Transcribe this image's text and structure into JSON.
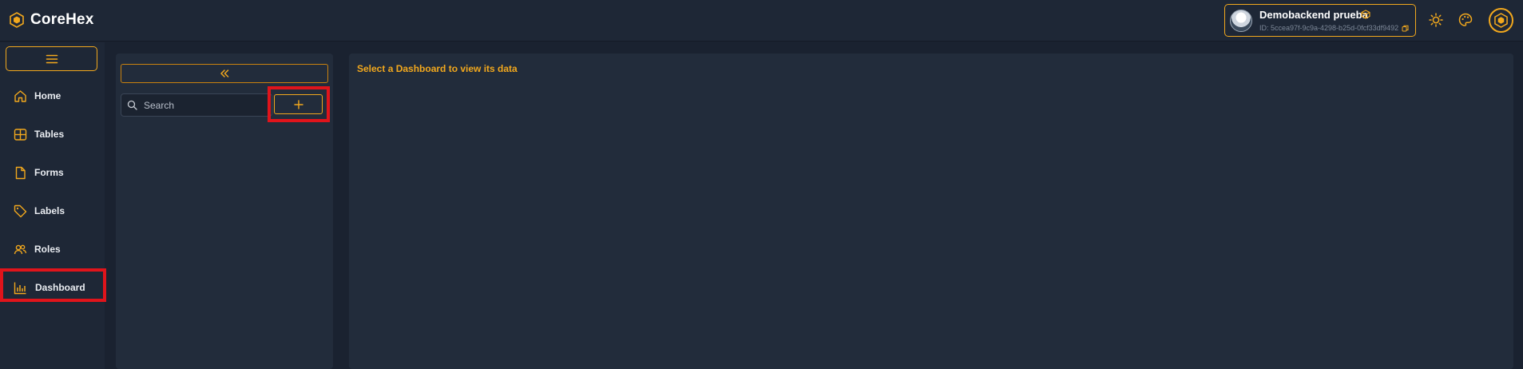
{
  "app": {
    "name": "CoreHex",
    "accent_color": "#f2a81d",
    "highlight_color": "#e0141b"
  },
  "header": {
    "user": {
      "name": "Demobackend prueba",
      "id_text": "ID: 5ccea97f-9c9a-4298-b25d-0fcf33df9492"
    },
    "icons": [
      "cube-icon",
      "copy-icon",
      "sun-icon",
      "palette-icon",
      "hexagon-logo-icon"
    ]
  },
  "sidebar": {
    "items": [
      {
        "label": "Home",
        "icon": "home-icon"
      },
      {
        "label": "Tables",
        "icon": "table-icon"
      },
      {
        "label": "Forms",
        "icon": "file-icon"
      },
      {
        "label": "Labels",
        "icon": "tag-icon"
      },
      {
        "label": "Roles",
        "icon": "users-icon"
      },
      {
        "label": "Dashboard",
        "icon": "bar-chart-icon",
        "active": true
      }
    ]
  },
  "list_panel": {
    "search_placeholder": "Search",
    "add_symbol": "+"
  },
  "main": {
    "empty_message": "Select a Dashboard to view its data"
  }
}
